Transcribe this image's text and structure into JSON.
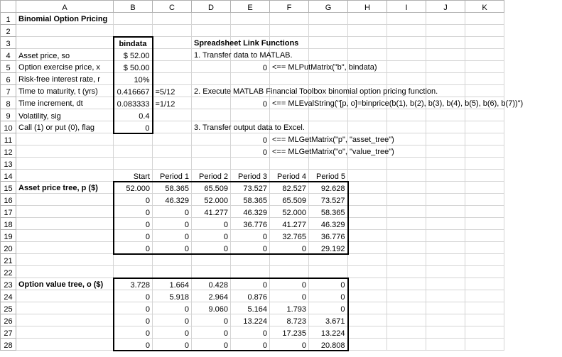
{
  "columns": [
    "",
    "A",
    "B",
    "C",
    "D",
    "E",
    "F",
    "G",
    "H",
    "I",
    "J",
    "K"
  ],
  "rows": [
    "1",
    "2",
    "3",
    "4",
    "5",
    "6",
    "7",
    "8",
    "9",
    "10",
    "11",
    "12",
    "13",
    "14",
    "15",
    "16",
    "17",
    "18",
    "19",
    "20",
    "21",
    "22",
    "23",
    "24",
    "25",
    "26",
    "27",
    "28"
  ],
  "title": "Binomial Option Pricing",
  "bindataHeader": "bindata",
  "slfHeader": "Spreadsheet Link Functions",
  "inputs": {
    "assetPriceLabel": "Asset price, so",
    "assetPriceValue": "$   52.00",
    "exerciseLabel": "Option exercise price, x",
    "exerciseValue": "$   50.00",
    "rateLabel": "Risk-free interest rate, r",
    "rateValue": "10%",
    "maturityLabel": "Time to maturity, t (yrs)",
    "maturityValue": "0.416667",
    "maturityFormula": "=5/12",
    "incrementLabel": "Time increment, dt",
    "incrementValue": "0.083333",
    "incrementFormula": "=1/12",
    "volatilityLabel": "Volatility, sig",
    "volatilityValue": "0.4",
    "flagLabel": "Call (1) or put (0), flag",
    "flagValue": "0"
  },
  "slf": {
    "step1": "1.  Transfer data to MATLAB.",
    "step1ret": "0",
    "step1code": "<== MLPutMatrix(\"b\", bindata)",
    "step2": "2.  Execute MATLAB Financial Toolbox binomial option pricing function.",
    "step2ret": "0",
    "step2code": "<== MLEvalString(\"[p, o]=binprice(b(1), b(2), b(3), b(4), b(5), b(6), b(7))\")",
    "step3": "3.  Transfer output data to Excel.",
    "step3ret1": "0",
    "step3code1": "<== MLGetMatrix(\"p\", \"asset_tree\")",
    "step3ret2": "0",
    "step3code2": "<== MLGetMatrix(\"o\", \"value_tree\")"
  },
  "periods": [
    "Start",
    "Period 1",
    "Period 2",
    "Period 3",
    "Period 4",
    "Period 5"
  ],
  "priceTreeLabel": "Asset price tree, p ($)",
  "valueTreeLabel": "Option value tree, o ($)",
  "priceTree": [
    [
      "52.000",
      "58.365",
      "65.509",
      "73.527",
      "82.527",
      "92.628"
    ],
    [
      "0",
      "46.329",
      "52.000",
      "58.365",
      "65.509",
      "73.527"
    ],
    [
      "0",
      "0",
      "41.277",
      "46.329",
      "52.000",
      "58.365"
    ],
    [
      "0",
      "0",
      "0",
      "36.776",
      "41.277",
      "46.329"
    ],
    [
      "0",
      "0",
      "0",
      "0",
      "32.765",
      "36.776"
    ],
    [
      "0",
      "0",
      "0",
      "0",
      "0",
      "29.192"
    ]
  ],
  "valueTree": [
    [
      "3.728",
      "1.664",
      "0.428",
      "0",
      "0",
      "0"
    ],
    [
      "0",
      "5.918",
      "2.964",
      "0.876",
      "0",
      "0"
    ],
    [
      "0",
      "0",
      "9.060",
      "5.164",
      "1.793",
      "0"
    ],
    [
      "0",
      "0",
      "0",
      "13.224",
      "8.723",
      "3.671"
    ],
    [
      "0",
      "0",
      "0",
      "0",
      "17.235",
      "13.224"
    ],
    [
      "0",
      "0",
      "0",
      "0",
      "0",
      "20.808"
    ]
  ],
  "chart_data": {
    "type": "table",
    "title": "Binomial Option Pricing",
    "inputs": {
      "asset_price_so": 52.0,
      "exercise_price_x": 50.0,
      "risk_free_rate_r": 0.1,
      "time_to_maturity_yrs": 0.416667,
      "time_increment_dt": 0.083333,
      "volatility_sig": 0.4,
      "call1_put0_flag": 0
    },
    "asset_price_tree_p": [
      [
        52.0,
        58.365,
        65.509,
        73.527,
        82.527,
        92.628
      ],
      [
        0,
        46.329,
        52.0,
        58.365,
        65.509,
        73.527
      ],
      [
        0,
        0,
        41.277,
        46.329,
        52.0,
        58.365
      ],
      [
        0,
        0,
        0,
        36.776,
        41.277,
        46.329
      ],
      [
        0,
        0,
        0,
        0,
        32.765,
        36.776
      ],
      [
        0,
        0,
        0,
        0,
        0,
        29.192
      ]
    ],
    "option_value_tree_o": [
      [
        3.728,
        1.664,
        0.428,
        0,
        0,
        0
      ],
      [
        0,
        5.918,
        2.964,
        0.876,
        0,
        0
      ],
      [
        0,
        0,
        9.06,
        5.164,
        1.793,
        0
      ],
      [
        0,
        0,
        0,
        13.224,
        8.723,
        3.671
      ],
      [
        0,
        0,
        0,
        0,
        17.235,
        13.224
      ],
      [
        0,
        0,
        0,
        0,
        0,
        20.808
      ]
    ],
    "periods": [
      "Start",
      "Period 1",
      "Period 2",
      "Period 3",
      "Period 4",
      "Period 5"
    ]
  }
}
